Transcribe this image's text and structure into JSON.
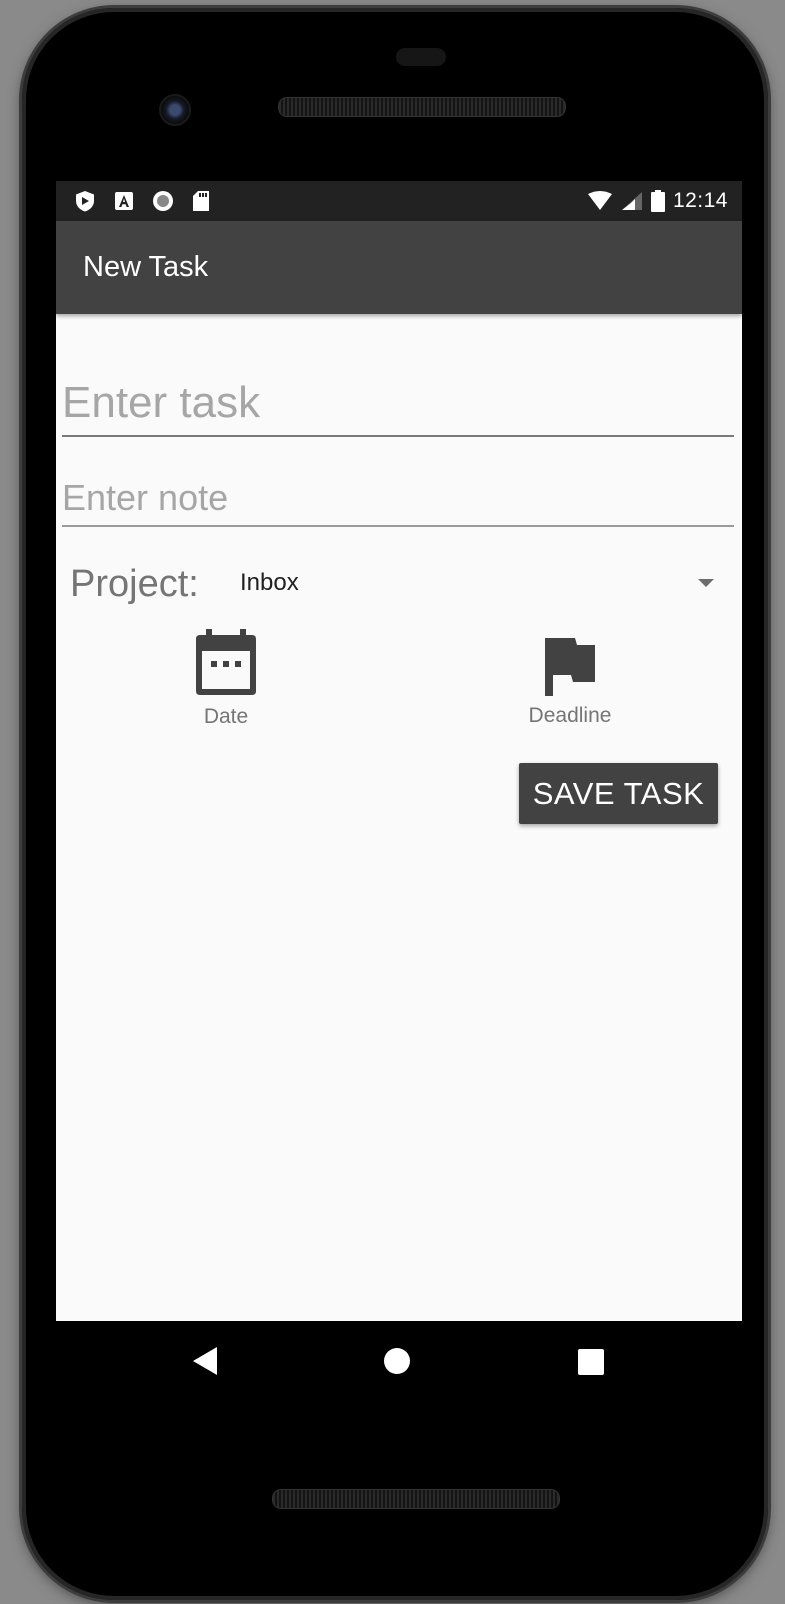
{
  "status_bar": {
    "time": "12:14",
    "left_icons": [
      "shield-icon",
      "a-box-icon",
      "record-icon",
      "sd-card-icon"
    ],
    "right_icons": [
      "wifi-icon",
      "signal-icon",
      "battery-icon"
    ]
  },
  "app_bar": {
    "title": "New Task"
  },
  "form": {
    "task_value": "",
    "task_placeholder": "Enter task",
    "note_value": "",
    "note_placeholder": "Enter note",
    "project_label": "Project:",
    "project_selected": "Inbox",
    "date_label": "Date",
    "deadline_label": "Deadline",
    "save_label": "SAVE TASK"
  },
  "nav_bar": {
    "buttons": [
      "back-icon",
      "home-icon",
      "recents-icon"
    ]
  },
  "colors": {
    "app_bar": "#424242",
    "status_bar": "#222222",
    "screen_background": "#fafafa",
    "icon": "#424242",
    "secondary_text": "#757575"
  }
}
